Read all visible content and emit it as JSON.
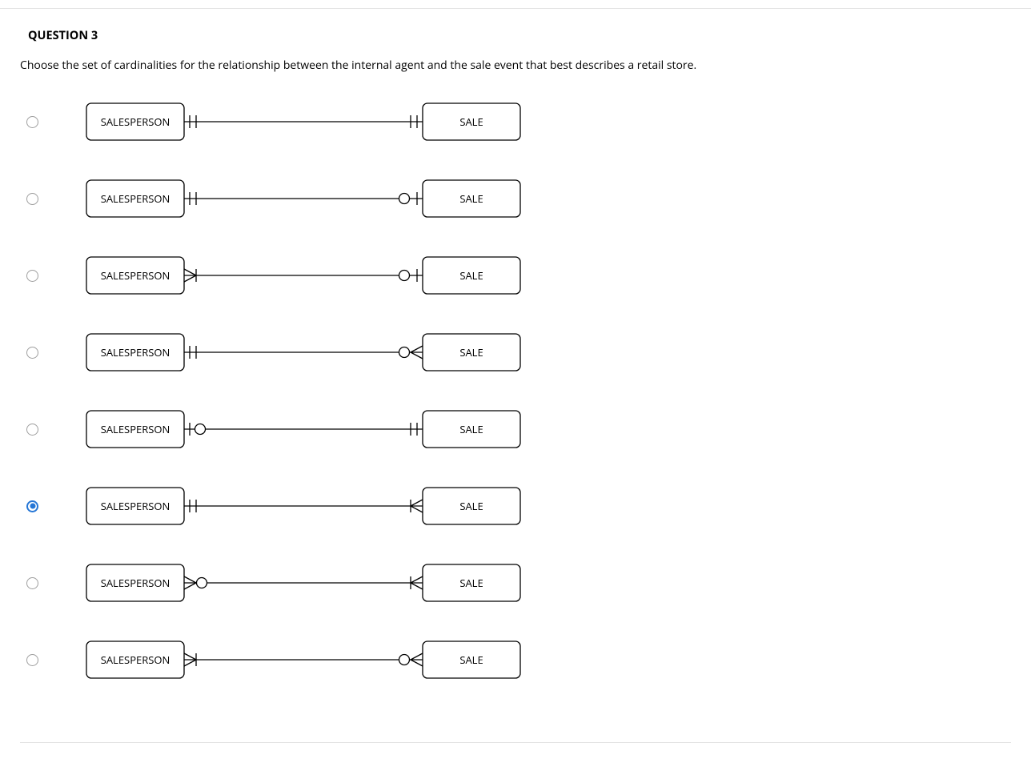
{
  "question": {
    "title": "QUESTION 3",
    "prompt": "Choose the set of cardinalities for the relationship between the internal agent and the sale event that best describes a retail store."
  },
  "entities": {
    "left": "SALESPERSON",
    "right": "SALE"
  },
  "options": [
    {
      "left_notation": "one_one",
      "right_notation": "one_one",
      "selected": false
    },
    {
      "left_notation": "one_one",
      "right_notation": "zero_one",
      "selected": false
    },
    {
      "left_notation": "many_one",
      "right_notation": "zero_one",
      "selected": false
    },
    {
      "left_notation": "one_one",
      "right_notation": "zero_many",
      "selected": false
    },
    {
      "left_notation": "one_zero",
      "right_notation": "one_one",
      "selected": false
    },
    {
      "left_notation": "one_one",
      "right_notation": "one_many",
      "selected": true
    },
    {
      "left_notation": "many_zero",
      "right_notation": "one_many",
      "selected": false
    },
    {
      "left_notation": "many_one",
      "right_notation": "zero_many",
      "selected": false
    }
  ]
}
